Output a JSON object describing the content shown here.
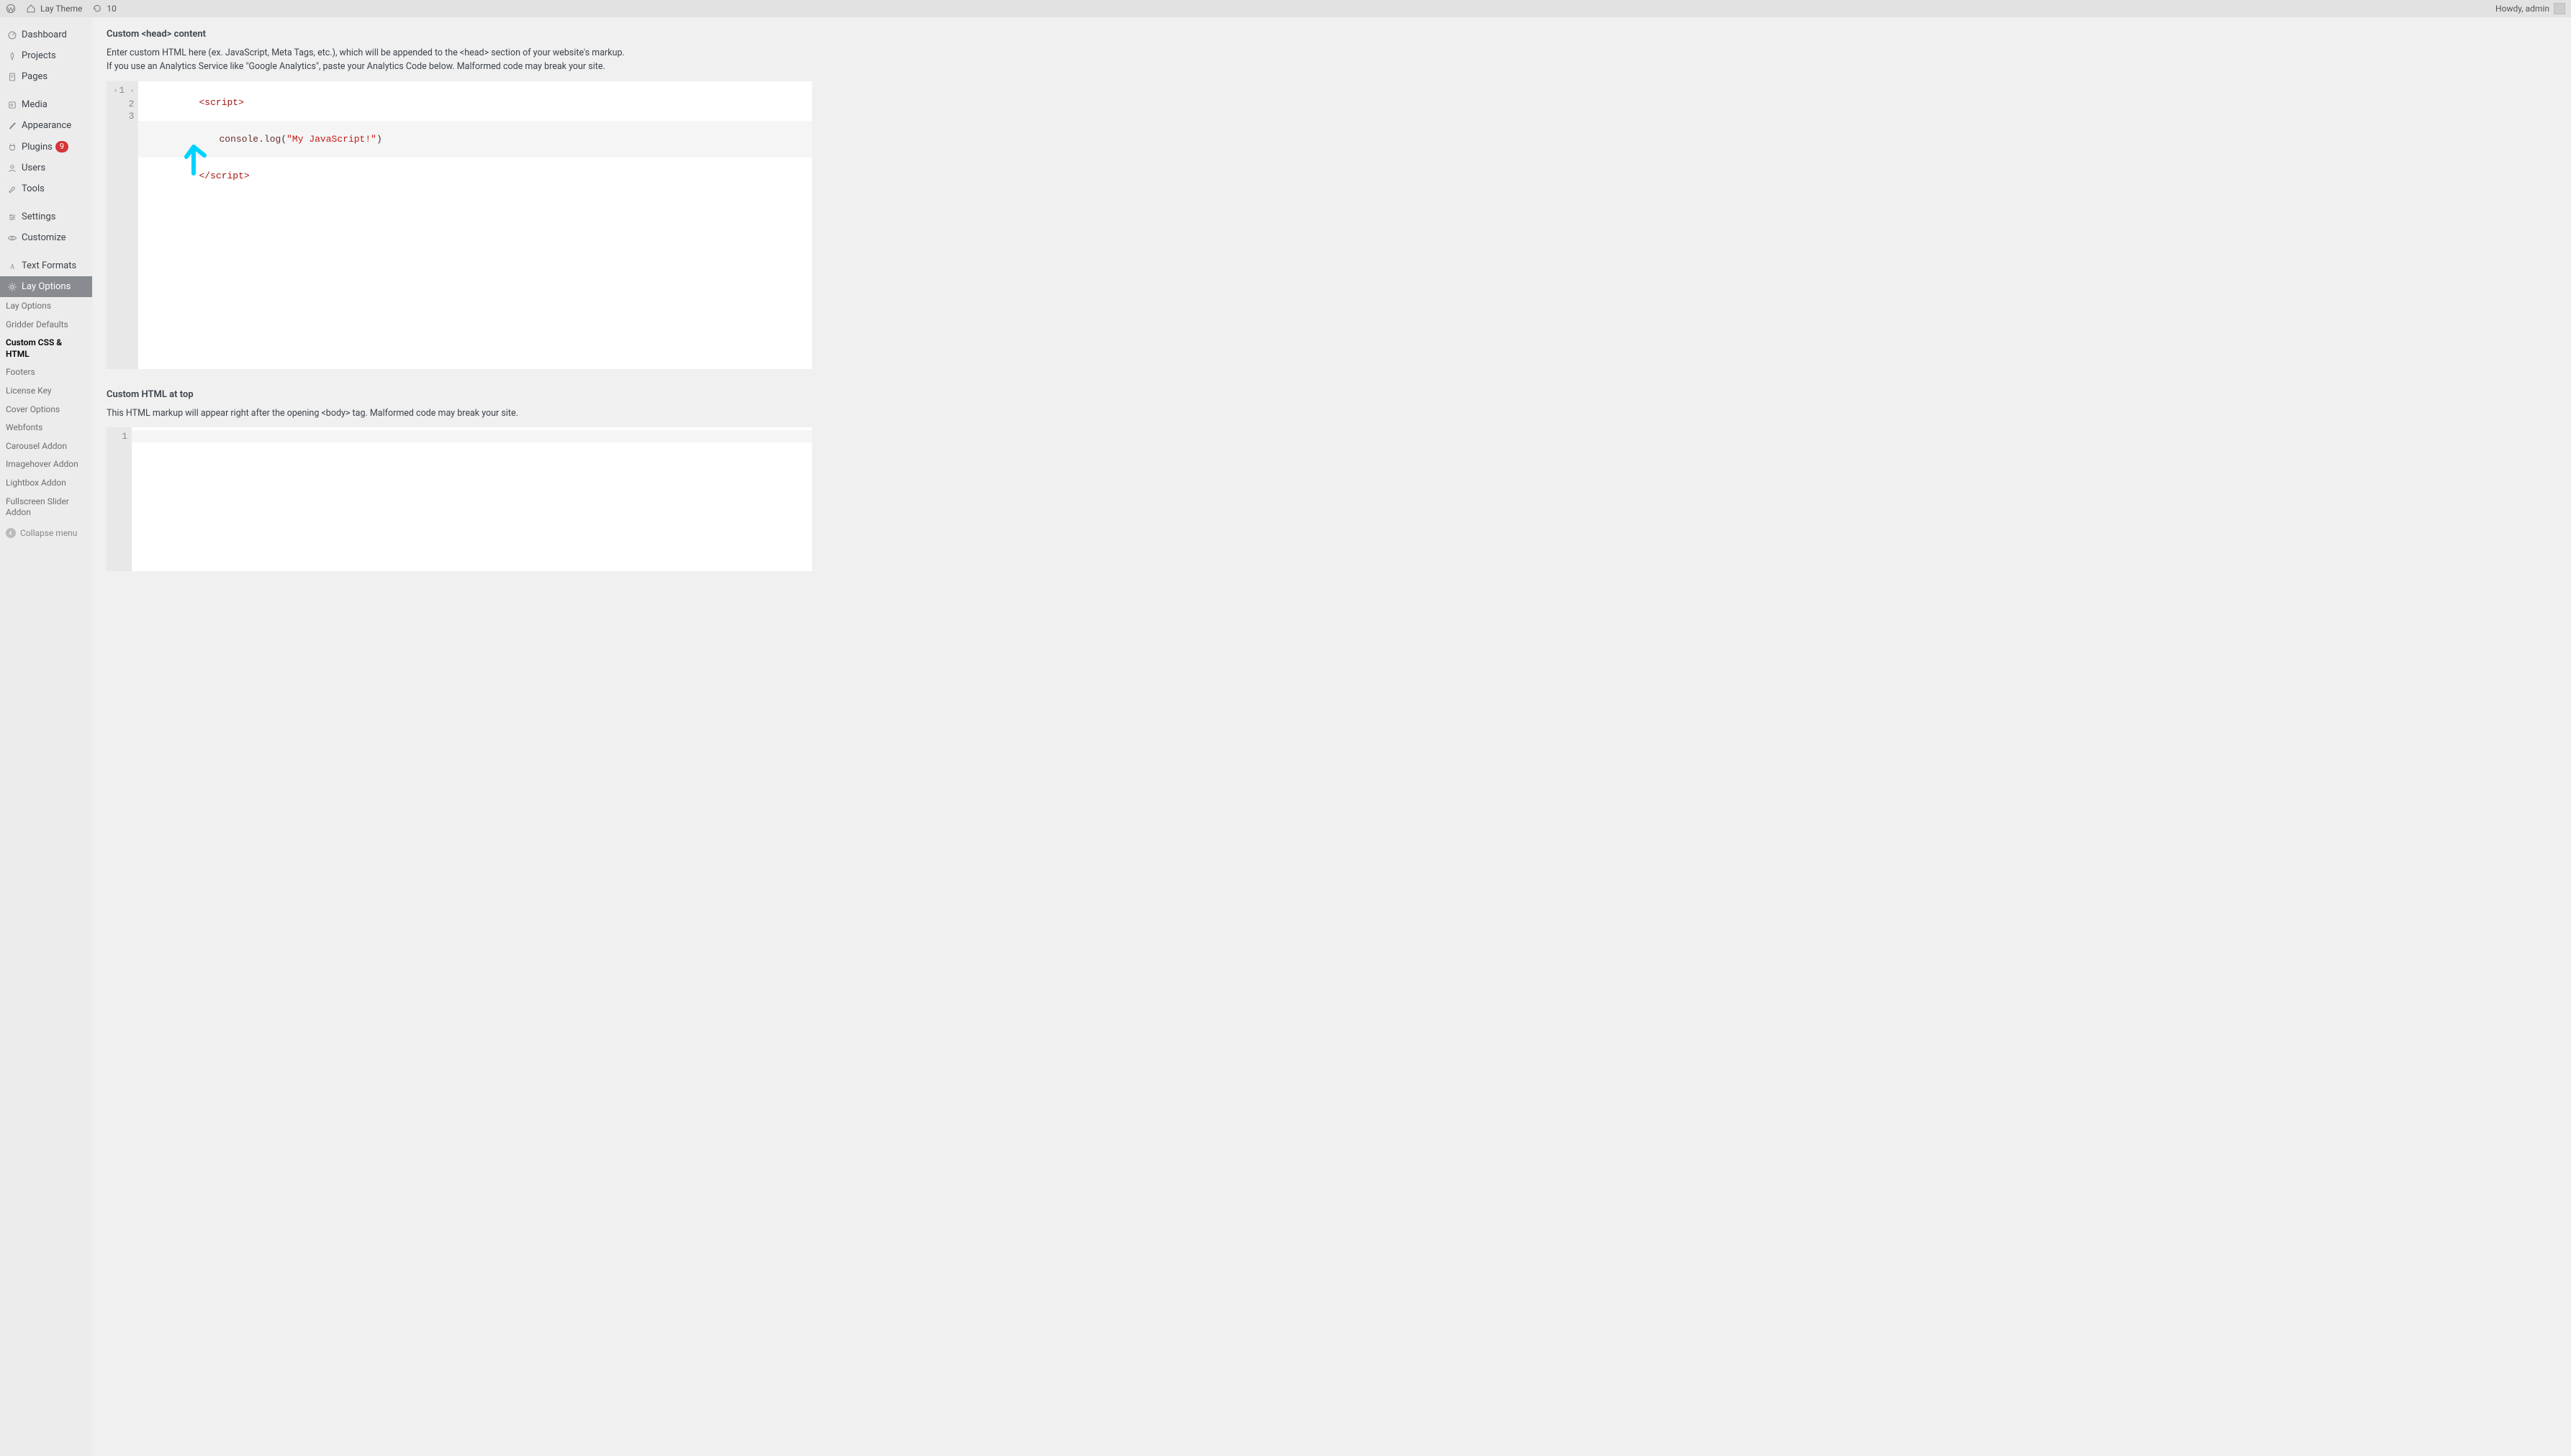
{
  "adminbar": {
    "site_name": "Lay Theme",
    "refresh_count": "10",
    "greeting": "Howdy, admin"
  },
  "sidebar": {
    "main": [
      {
        "label": "Dashboard",
        "icon": "gauge"
      },
      {
        "label": "Projects",
        "icon": "pin"
      },
      {
        "label": "Pages",
        "icon": "page"
      },
      {
        "label": "Media",
        "icon": "media"
      },
      {
        "label": "Appearance",
        "icon": "brush"
      },
      {
        "label": "Plugins",
        "icon": "plug",
        "badge": "9"
      },
      {
        "label": "Users",
        "icon": "user"
      },
      {
        "label": "Tools",
        "icon": "wrench"
      },
      {
        "label": "Settings",
        "icon": "sliders"
      },
      {
        "label": "Customize",
        "icon": "eye"
      },
      {
        "label": "Text Formats",
        "icon": "letter-a"
      },
      {
        "label": "Lay Options",
        "icon": "gear",
        "current": true
      }
    ],
    "submenu": [
      {
        "label": "Lay Options"
      },
      {
        "label": "Gridder Defaults"
      },
      {
        "label": "Custom CSS & HTML",
        "current": true
      },
      {
        "label": "Footers"
      },
      {
        "label": "License Key"
      },
      {
        "label": "Cover Options"
      },
      {
        "label": "Webfonts"
      },
      {
        "label": "Carousel Addon"
      },
      {
        "label": "Imagehover Addon"
      },
      {
        "label": "Lightbox Addon"
      },
      {
        "label": "Fullscreen Slider Addon"
      }
    ],
    "collapse": "Collapse menu"
  },
  "sections": {
    "head": {
      "title": "Custom <head> content",
      "desc": "Enter custom HTML here (ex. JavaScript, Meta Tags, etc.), which will be appended to the <head> section of your website's markup. If you use an Analytics Service like \"Google Analytics\", paste your Analytics Code below. Malformed code may break your site.",
      "code": {
        "lines": [
          "1",
          "2",
          "3"
        ],
        "l1_open_lt": "<",
        "l1_open_tag": "script",
        "l1_open_gt": ">",
        "l2_obj": "console",
        "l2_dot": ".",
        "l2_fn": "log",
        "l2_open_paren": "(",
        "l2_str": "\"My JavaScript!\"",
        "l2_close_paren": ")",
        "l3_close_lt": "</",
        "l3_close_tag": "script",
        "l3_close_gt": ">"
      }
    },
    "top": {
      "title": "Custom HTML at top",
      "desc": "This HTML markup will appear right after the opening <body> tag. Malformed code may break your site.",
      "code": {
        "lines": [
          "1"
        ]
      }
    }
  }
}
